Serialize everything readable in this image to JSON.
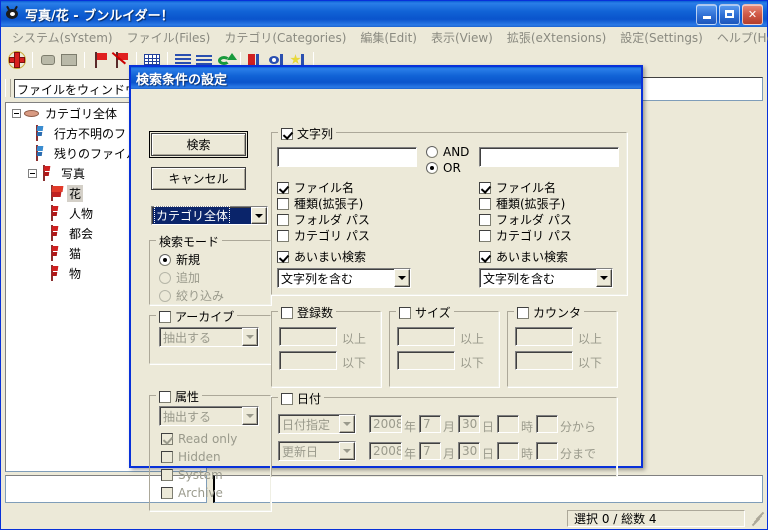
{
  "window": {
    "title": "写真/花 - ブンルイダー！",
    "icon": "app-eye-icon",
    "buttons": {
      "minimize": "_",
      "maximize": "□",
      "close": "✕"
    }
  },
  "menubar": {
    "items": [
      {
        "label": "システム(sYstem)"
      },
      {
        "label": "ファイル(Files)"
      },
      {
        "label": "カテゴリ(Categories)"
      },
      {
        "label": "編集(Edit)"
      },
      {
        "label": "表示(View)"
      },
      {
        "label": "拡張(eXtensions)"
      },
      {
        "label": "設定(Settings)"
      },
      {
        "label": "ヘルプ(Help)"
      }
    ]
  },
  "toolbar": {
    "icons": [
      "red-cross-add-icon",
      "gray-tag-icon",
      "gray-shape-icon",
      "red-flag-icon",
      "red-flag-delete-icon",
      "grid-view-icon",
      "list-rows-icon",
      "detail-rows-icon",
      "refresh-arrow-icon",
      "mixed-sort-icon",
      "eye-preview-icon",
      "star-favorite-icon"
    ]
  },
  "path_bar": {
    "value": "ファイルをウィンドウ左"
  },
  "tree": {
    "items": [
      {
        "label": "カテゴリ全体",
        "icon": "category-disk-icon",
        "indent": 0,
        "expander": "minus",
        "selected": false
      },
      {
        "label": "行方不明のフ",
        "icon": "blue-flag-icon",
        "indent": 1,
        "expander": "none",
        "selected": false
      },
      {
        "label": "残りのファイル",
        "icon": "blue-flag-icon",
        "indent": 1,
        "expander": "none",
        "selected": false
      },
      {
        "label": "写真",
        "icon": "red-flag-icon",
        "indent": 1,
        "expander": "minus",
        "selected": false
      },
      {
        "label": "花",
        "icon": "red-flag-wide-icon",
        "indent": 2,
        "expander": "none",
        "selected": true
      },
      {
        "label": "人物",
        "icon": "red-flag-icon",
        "indent": 2,
        "expander": "none",
        "selected": false
      },
      {
        "label": "都会",
        "icon": "red-flag-icon",
        "indent": 2,
        "expander": "none",
        "selected": false
      },
      {
        "label": "猫",
        "icon": "red-flag-icon",
        "indent": 2,
        "expander": "none",
        "selected": false
      },
      {
        "label": "物",
        "icon": "red-flag-icon",
        "indent": 2,
        "expander": "none",
        "selected": false
      }
    ]
  },
  "statusbar": {
    "text": "選択 0 / 総数 4"
  },
  "dialog": {
    "title": "検索条件の設定",
    "buttons": {
      "search": "検索",
      "cancel": "キャンセル"
    },
    "category_combo": {
      "value": "カテゴリ全体"
    },
    "search_mode": {
      "title": "検索モード",
      "options": [
        {
          "label": "新規",
          "selected": true,
          "disabled": false
        },
        {
          "label": "追加",
          "selected": false,
          "disabled": true
        },
        {
          "label": "絞り込み",
          "selected": false,
          "disabled": true
        }
      ]
    },
    "archive": {
      "title": "アーカイブ",
      "checked": false,
      "combo_value": "抽出する"
    },
    "attributes": {
      "title": "属性",
      "checked": false,
      "combo_value": "抽出する",
      "items": [
        {
          "label": "Read only",
          "checked": true
        },
        {
          "label": "Hidden",
          "checked": false
        },
        {
          "label": "System",
          "checked": false
        },
        {
          "label": "Archive",
          "checked": false
        }
      ]
    },
    "string_group": {
      "title": "文字列",
      "checked": true,
      "left_value": "",
      "right_value": "",
      "operators": [
        {
          "label": "AND",
          "selected": false
        },
        {
          "label": "OR",
          "selected": true
        }
      ],
      "left_column": {
        "checks": [
          {
            "label": "ファイル名",
            "checked": true
          },
          {
            "label": "種類(拡張子)",
            "checked": false
          },
          {
            "label": "フォルダ パス",
            "checked": false
          },
          {
            "label": "カテゴリ パス",
            "checked": false
          }
        ],
        "fuzzy": {
          "label": "あいまい検索",
          "checked": true
        },
        "match_combo": "文字列を含む"
      },
      "right_column": {
        "checks": [
          {
            "label": "ファイル名",
            "checked": true
          },
          {
            "label": "種類(拡張子)",
            "checked": false
          },
          {
            "label": "フォルダ パス",
            "checked": false
          },
          {
            "label": "カテゴリ パス",
            "checked": false
          }
        ],
        "fuzzy": {
          "label": "あいまい検索",
          "checked": true
        },
        "match_combo": "文字列を含む"
      }
    },
    "count_group": {
      "title": "登録数",
      "checked": false,
      "min_value": "",
      "max_value": "",
      "min_label": "以上",
      "max_label": "以下"
    },
    "size_group": {
      "title": "サイズ",
      "checked": false,
      "min_value": "",
      "max_value": "",
      "min_label": "以上",
      "max_label": "以下"
    },
    "counter_group": {
      "title": "カウンタ",
      "checked": false,
      "min_value": "",
      "max_value": "",
      "min_label": "以上",
      "max_label": "以下"
    },
    "date_group": {
      "title": "日付",
      "checked": false,
      "row1": {
        "combo": "日付指定",
        "year": "2008",
        "year_label": "年",
        "month": "7",
        "month_label": "月",
        "day": "30",
        "day_label": "日",
        "hour": "",
        "hour_label": "時",
        "minute": "",
        "minute_label": "分から"
      },
      "row2": {
        "combo": "更新日",
        "year": "2008",
        "year_label": "年",
        "month": "7",
        "month_label": "月",
        "day": "30",
        "day_label": "日",
        "hour": "",
        "hour_label": "時",
        "minute": "",
        "minute_label": "分まで"
      }
    }
  }
}
